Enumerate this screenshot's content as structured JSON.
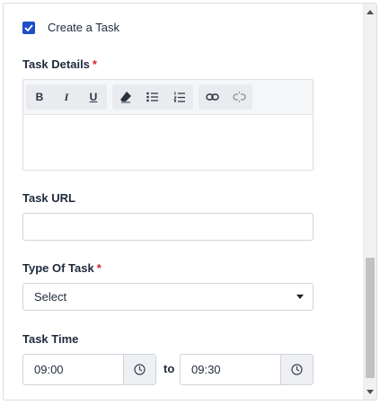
{
  "create_task": {
    "label": "Create a Task",
    "checked": true
  },
  "task_details": {
    "label": "Task Details",
    "required_mark": "*"
  },
  "toolbar": {
    "bold": "B",
    "italic": "I",
    "underline": "U"
  },
  "task_url": {
    "label": "Task URL",
    "value": ""
  },
  "type_of_task": {
    "label": "Type Of Task",
    "required_mark": "*",
    "selected": "Select"
  },
  "task_time": {
    "label": "Task Time",
    "start": "09:00",
    "separator": "to",
    "end": "09:30"
  },
  "colors": {
    "accent": "#1c4fc9",
    "required": "#d0272d"
  }
}
